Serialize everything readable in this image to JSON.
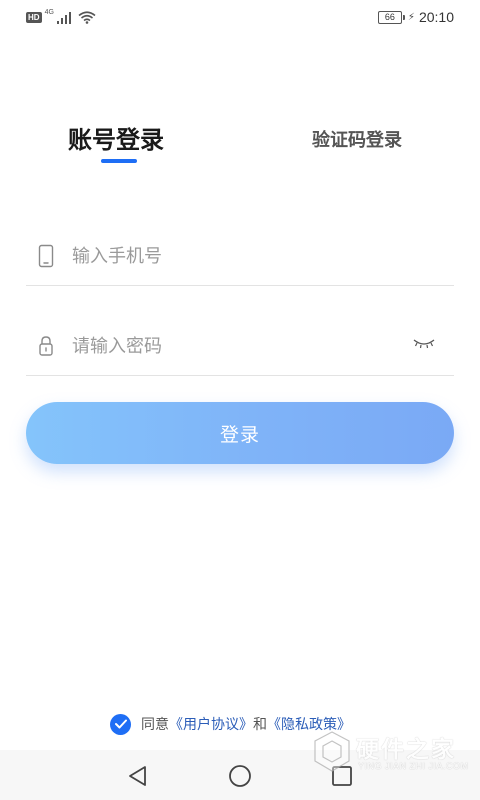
{
  "status_bar": {
    "hd": "HD",
    "network": "4G",
    "battery": "66",
    "time": "20:10"
  },
  "tabs": {
    "account_login": "账号登录",
    "code_login": "验证码登录"
  },
  "phone_field": {
    "placeholder": "输入手机号",
    "value": ""
  },
  "password_field": {
    "placeholder": "请输入密码",
    "value": ""
  },
  "login_button": "登录",
  "agreement": {
    "prefix": "同意",
    "user_agreement": "《用户协议》",
    "and": "和",
    "privacy_policy": "《隐私政策》",
    "checked": true
  },
  "watermark": {
    "title": "硬件之家",
    "subtitle": "YING JIAN ZHI JIA.COM"
  },
  "colors": {
    "accent": "#1e6ef5",
    "button_gradient_start": "#84c4fb",
    "button_gradient_end": "#7aa9f5",
    "link": "#2b5db8"
  },
  "icons": {
    "phone": "smartphone-icon",
    "lock": "lock-icon",
    "eye": "eye-closed-icon",
    "check": "check-icon",
    "back": "back-triangle-icon",
    "home": "home-circle-icon",
    "recent": "recent-square-icon"
  }
}
